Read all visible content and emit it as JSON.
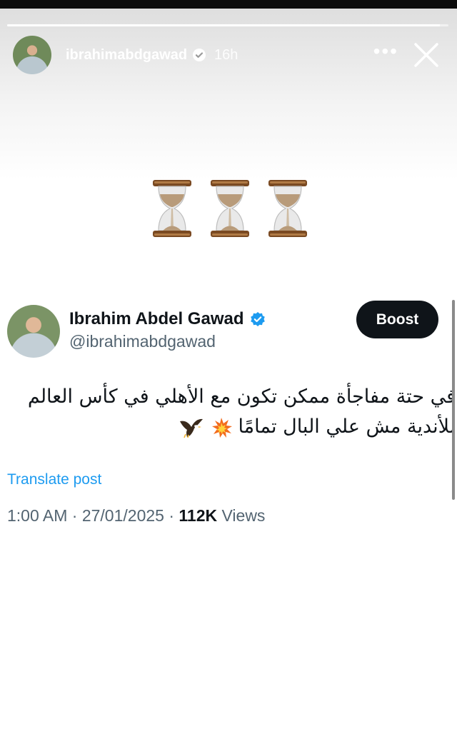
{
  "story": {
    "username": "ibrahimabdgawad",
    "time": "16h",
    "more_label": "•••",
    "progress": 0.98
  },
  "tweet": {
    "display_name": "Ibrahim Abdel Gawad",
    "handle": "@ibrahimabdgawad",
    "boost_label": "Boost",
    "text_line1": "في حتة مفاجأة ممكن تكون مع الأهلي في كأس العالم",
    "text_line2": "للأندية مش علي البال تمامًا",
    "translate_label": "Translate post",
    "timestamp": "1:00 AM · 27/01/2025 · ",
    "views_count": "112K",
    "views_label": " Views"
  },
  "icons": {
    "story_avatar": "profile-photo",
    "verified": "verified-badge-icon",
    "close": "close-icon",
    "more": "more-dots-icon",
    "hourglass": "hourglass-icon",
    "explosion": "collision-emoji-icon",
    "eagle": "eagle-emoji-icon"
  },
  "colors": {
    "accent": "#1d9bf0",
    "boost_bg": "#0f1419",
    "handle": "#536471"
  }
}
